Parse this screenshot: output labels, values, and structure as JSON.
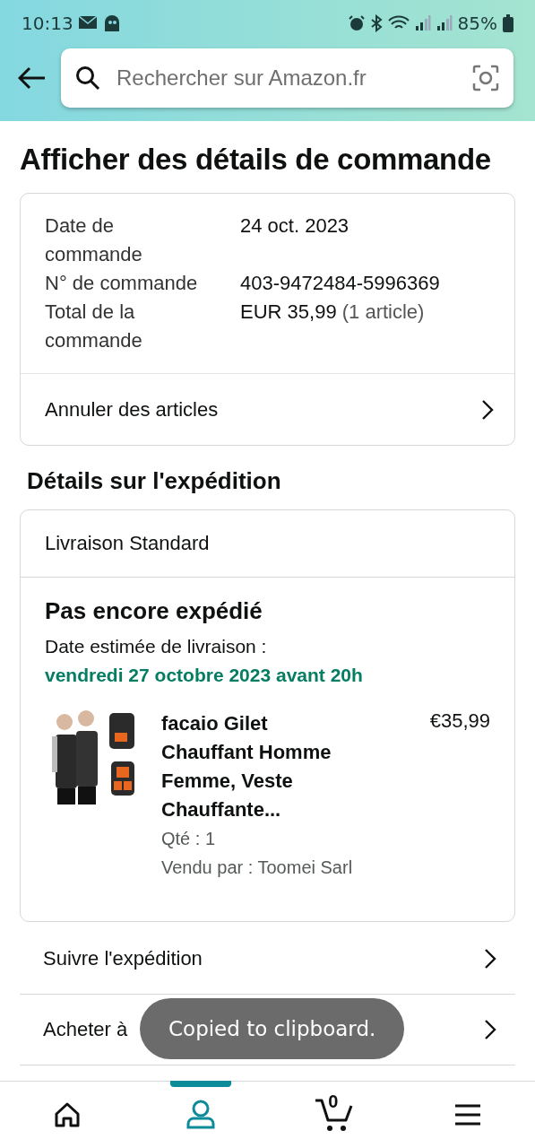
{
  "status_bar": {
    "time": "10:13",
    "battery": "85%"
  },
  "search": {
    "placeholder": "Rechercher sur Amazon.fr"
  },
  "title": "Afficher des détails de commande",
  "order_summary": {
    "rows": [
      {
        "label": "Date de commande",
        "value": "24 oct. 2023"
      },
      {
        "label": "N° de commande",
        "value": "403-9472484-5996369"
      },
      {
        "label": "Total de la commande",
        "value": "EUR 35,99",
        "note": "(1 article)"
      }
    ],
    "action": "Annuler des articles"
  },
  "shipping": {
    "heading": "Détails sur l'expédition",
    "method": "Livraison Standard",
    "status": "Pas encore expédié",
    "delivery_label": "Date estimée de livraison :",
    "delivery_date": "vendredi 27 octobre 2023 avant 20h",
    "item": {
      "title": "facaio Gilet Chauffant Homme Femme, Veste Chauffante...",
      "price": "€35,99",
      "quantity": "Qté : 1",
      "seller": "Vendu par : Toomei Sarl"
    }
  },
  "actions": [
    "Suivre l'expédition",
    "Acheter à"
  ],
  "toast": "Copied to clipboard.",
  "nav": [
    {
      "kind": "home",
      "selected": false
    },
    {
      "kind": "account",
      "selected": true
    },
    {
      "kind": "cart",
      "count": "0",
      "selected": false
    },
    {
      "kind": "menu",
      "selected": false
    }
  ]
}
